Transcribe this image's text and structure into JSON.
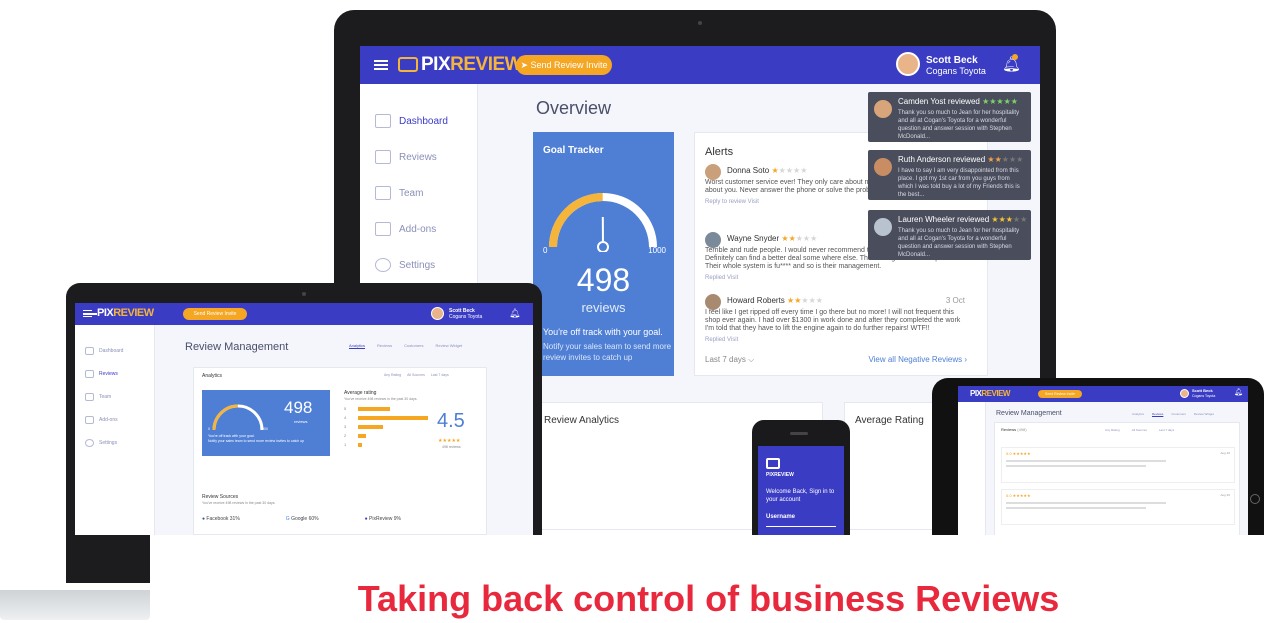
{
  "app": {
    "logo_pix": "PIX",
    "logo_review": "REVIEW",
    "invite_button": "Send Review Invite"
  },
  "user": {
    "name": "Scott Beck",
    "company": "Cogans Toyota"
  },
  "desktop": {
    "nav": [
      "Dashboard",
      "Reviews",
      "Team",
      "Add-ons",
      "Settings"
    ],
    "page_title": "Overview",
    "goal_tracker": {
      "title": "Goal Tracker",
      "min": "0",
      "max": "1000",
      "count": "498",
      "unit": "reviews",
      "progress": 0.498,
      "message": "You're off track with your goal.",
      "sub_message": "Notify your sales team to send more review invites to catch up"
    },
    "alerts": {
      "title": "Alerts",
      "items": [
        {
          "name": "Donna Soto",
          "rating": 1,
          "text": "Worst customer service ever! They only care about money. They don't care shit about you. Never answer the phone or solve the problem. Shame sung this place.",
          "actions": "Reply to review   Visit"
        },
        {
          "name": "Wayne Snyder",
          "rating": 2,
          "text": "Terrible and rude people. I would never recommend this place. Service sucks!! Definitely can find a better deal some where else. The management incompetent. Their whole system is fu**** and so is their management.",
          "actions": "Replied   Visit"
        },
        {
          "name": "Howard Roberts",
          "rating": 2,
          "date": "3 Oct",
          "text": "I feel like I get ripped off every time I go there but no more! I will not frequent this shop ever again. I had over $1300 in work done and after they completed the work I'm told that they have to lift the engine again to do further repairs! WTF!!",
          "actions": "Replied   Visit"
        }
      ],
      "range": "Last 7 days",
      "view_all": "View all Negative Reviews"
    },
    "toasts": [
      {
        "name": "Camden Yost",
        "verb": "reviewed",
        "rating": 5,
        "text": "Thank you so much to Jean for her hospitality and all at Cogan's Toyota for a wonderful question and answer session with Stephen McDonald..."
      },
      {
        "name": "Ruth Anderson",
        "verb": "reviewed",
        "rating": 2,
        "text": "I have to say I am very disappointed from this place. I got my 1st car from you guys from which I was told buy a lot of my Friends this is the best..."
      },
      {
        "name": "Lauren Wheeler",
        "verb": "reviewed",
        "rating": 3,
        "text": "Thank you so much to Jean for her hospitality and all at Cogan's Toyota for a wonderful question and answer session with Stephen McDonald..."
      }
    ],
    "review_analytics": "Review Analytics",
    "average_rating": "Average Rating"
  },
  "laptop": {
    "nav": [
      "Dashboard",
      "Reviews",
      "Team",
      "Add-ons",
      "Settings"
    ],
    "page_title": "Review Management",
    "tabs": [
      "Analytics",
      "Reviews",
      "Customers",
      "Review Widget"
    ],
    "analytics_label": "Analytics",
    "filters": [
      "Any Rating",
      "All Sources",
      "Last 7 days"
    ],
    "count": "498",
    "unit": "reviews",
    "min": "0",
    "max": "1000",
    "message": "You're off track with your goal.",
    "sub_message": "Notify your sales team to send more review invites to catch up",
    "avg_title": "Average rating",
    "avg_sub": "You've receive 498 reviews in the past 30 days.",
    "avg_value": "4.5",
    "avg_reviews": "498 reviews",
    "bars": [
      {
        "star": "5",
        "value": 0.45
      },
      {
        "star": "4",
        "value": 1.0
      },
      {
        "star": "3",
        "value": 0.35
      },
      {
        "star": "2",
        "value": 0.12
      },
      {
        "star": "1",
        "value": 0.06
      }
    ],
    "sources_title": "Review Sources",
    "sources_sub": "You've receive 498 reviews in the past 30 days.",
    "sources": [
      {
        "name": "Facebook",
        "pct": "31%"
      },
      {
        "name": "Google",
        "pct": "60%"
      },
      {
        "name": "PixReview",
        "pct": "9%"
      }
    ]
  },
  "tablet": {
    "page_title": "Review Management",
    "tabs": [
      "Analytics",
      "Reviews",
      "Customers",
      "Review Widget"
    ],
    "reviews_label": "Reviews",
    "reviews_count": "(498)",
    "filters": [
      "Any Rating",
      "All Sources",
      "Last 7 days"
    ],
    "cards": [
      {
        "rating": "5.0 ★★★★★",
        "date": "Aug 26"
      },
      {
        "rating": "5.0 ★★★★★",
        "date": "Aug 26"
      }
    ]
  },
  "phone": {
    "welcome": "Welcome Back, Sign in to your account",
    "username": "Username"
  },
  "headline": "Taking back control of business Reviews",
  "colors": {
    "brand": "#3b3cc4",
    "accent": "#f5a623",
    "goal": "#4e7fd5",
    "headline": "#e8283c"
  }
}
